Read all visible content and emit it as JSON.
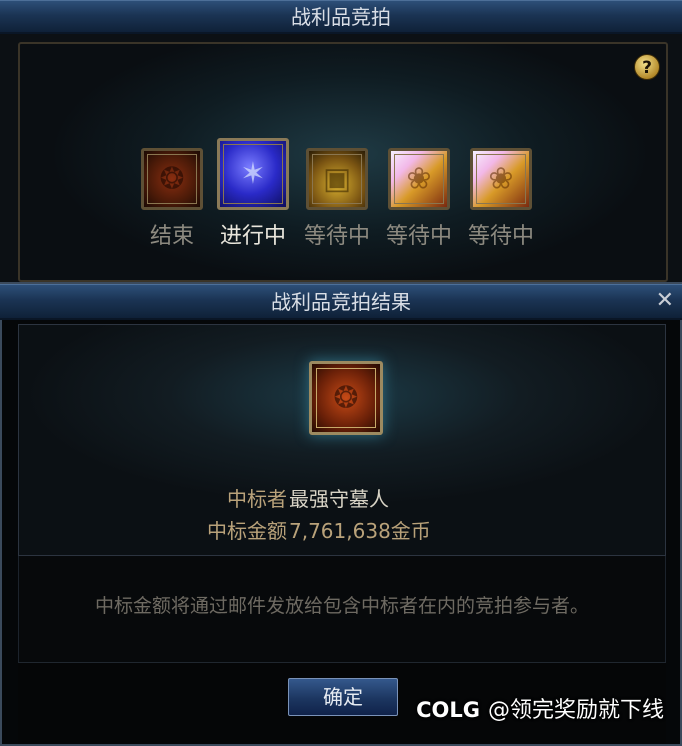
{
  "auction": {
    "title": "战利品竞拍",
    "help_label": "?",
    "items": [
      {
        "status": "结束",
        "icon": "ended-item-icon"
      },
      {
        "status": "进行中",
        "icon": "active-item-icon"
      },
      {
        "status": "等待中",
        "icon": "treasure-chest-icon"
      },
      {
        "status": "等待中",
        "icon": "golden-horn-icon"
      },
      {
        "status": "等待中",
        "icon": "golden-horn-icon"
      }
    ]
  },
  "result": {
    "title": "战利品竞拍结果",
    "close_label": "✕",
    "winner_label": "中标者",
    "winner_name": "最强守墓人",
    "amount_label": "中标金额",
    "amount_value": "7,761,638金币",
    "notice": "中标金额将通过邮件发放给包含中标者在内的竞拍参与者。",
    "confirm_label": "确定"
  },
  "watermark": {
    "logo": "COLG",
    "text": "@领完奖励就下线"
  },
  "colors": {
    "titlebar": "#1b3454",
    "gold_label": "#b9a27a",
    "status_text": "#8d8a80",
    "active_text": "#e9e6dc"
  }
}
